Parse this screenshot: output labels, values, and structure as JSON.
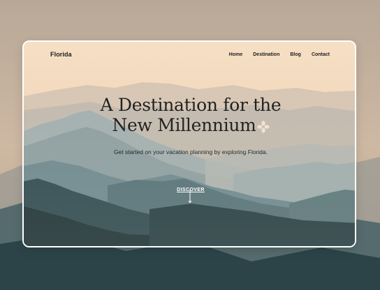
{
  "brand": {
    "name": "Florida"
  },
  "nav": {
    "items": [
      {
        "label": "Home"
      },
      {
        "label": "Destination"
      },
      {
        "label": "Blog"
      },
      {
        "label": "Contact"
      }
    ]
  },
  "hero": {
    "title_line1": "A Destination for the",
    "title_line2": "New Millennium",
    "subtitle": "Get started on your vacation planning by exploring Florida.",
    "cta_label": "DISCOVER"
  },
  "icons": {
    "title_ornament": "flower-icon",
    "cta_arrow": "arrow-down-icon"
  },
  "colors": {
    "sky": "#f3d9bd",
    "mountain_far": "#a9b5b4",
    "mountain_mid": "#5f7f86",
    "mountain_near": "#1f3c42",
    "text_dark": "#232323",
    "card_border": "#ffffff"
  }
}
